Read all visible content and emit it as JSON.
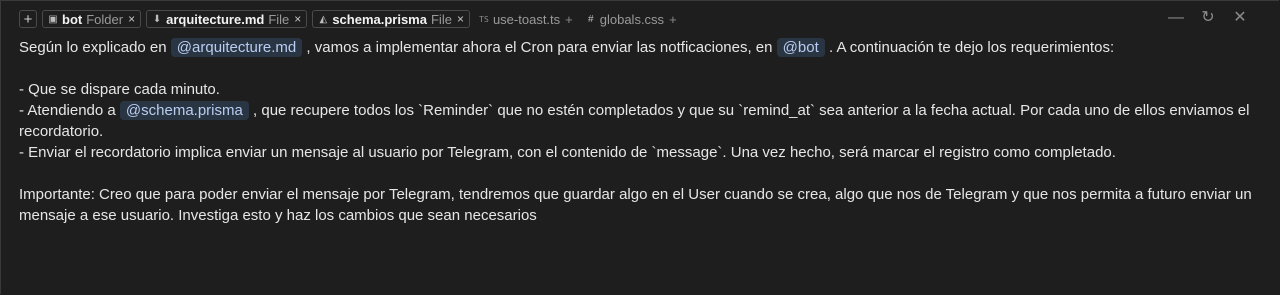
{
  "tabs": [
    {
      "icon": "bot-icon",
      "icon_glyph": "▣",
      "name": "bot",
      "type": "Folder",
      "close": "×"
    },
    {
      "icon": "markdown-icon",
      "icon_glyph": "⬇",
      "name": "arquitecture.md",
      "type": "File",
      "close": "×"
    },
    {
      "icon": "prisma-icon",
      "icon_glyph": "◭",
      "name": "schema.prisma",
      "type": "File",
      "close": "×"
    }
  ],
  "suggestions": [
    {
      "icon": "typescript-icon",
      "icon_glyph": "TS",
      "name": "use-toast.ts",
      "plus": "+"
    },
    {
      "icon": "css-icon",
      "icon_glyph": "#",
      "name": "globals.css",
      "plus": "+"
    }
  ],
  "add_label": "+",
  "window": {
    "minimize": "—",
    "refresh": "↻",
    "close": "✕"
  },
  "message": {
    "l1_a": "Según lo explicado en",
    "m_arch": "@arquitecture.md",
    "l1_b": ", vamos a implementar ahora el Cron para enviar las notficaciones, en",
    "m_bot": "@bot",
    "l1_c": ". A continuación te dejo los requerimientos:",
    "l2": "- Que se dispare cada minuto.",
    "l3_a": "- Atendiendo a",
    "m_schema": "@schema.prisma",
    "l3_b": ", que recupere todos los `Reminder` que no estén completados y que su `remind_at` sea anterior a la fecha actual. Por cada uno de ellos enviamos el recordatorio.",
    "l4": "- Enviar el recordatorio implica enviar un mensaje al usuario por Telegram, con el contenido de `message`. Una vez hecho, será marcar el registro como completado.",
    "l5": "Importante: Creo que para poder enviar el mensaje por Telegram, tendremos que guardar algo en el User cuando se crea, algo que nos de Telegram y que nos permita a futuro enviar un mensaje a ese usuario. Investiga esto y haz los cambios que sean necesarios"
  }
}
